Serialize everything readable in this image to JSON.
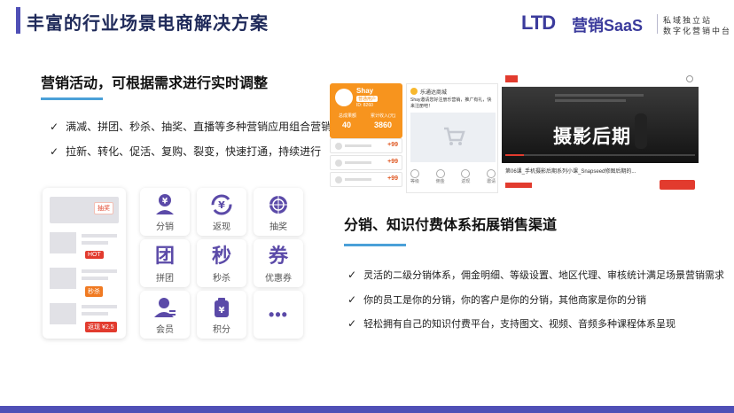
{
  "header": {
    "title": "丰富的行业场景电商解决方案",
    "logo_ltd": "LTD",
    "logo_brand": "营销SaaS",
    "tagline_1": "私域独立站",
    "tagline_2": "数字化营销中台"
  },
  "section1": {
    "title": "营销活动，可根据需求进行实时调整",
    "bullets": [
      "满减、拼团、秒杀、抽奖、直播等多种营销应用组合营销",
      "拉新、转化、促活、复购、裂变，快速打通，持续进行"
    ]
  },
  "phone": {
    "tag_lottery": "抽奖",
    "tag_hot": "HOT",
    "tag_seckill": "秒杀",
    "tag_rebate": "返现",
    "tag_price": "¥2.5"
  },
  "grid": [
    {
      "label": "分销",
      "icon": "money-person-icon"
    },
    {
      "label": "返现",
      "icon": "cashback-cycle-icon"
    },
    {
      "label": "抽奖",
      "icon": "lottery-wheel-icon"
    },
    {
      "label": "拼团",
      "icon": "group-tuan-icon",
      "glyph": "团"
    },
    {
      "label": "秒杀",
      "icon": "seckill-miao-icon",
      "glyph": "秒"
    },
    {
      "label": "优惠券",
      "icon": "coupon-quan-icon",
      "glyph": "券"
    },
    {
      "label": "会员",
      "icon": "member-user-icon"
    },
    {
      "label": "积分",
      "icon": "points-bag-icon"
    },
    {
      "label": "",
      "icon": "more-dots-icon",
      "glyph": "•••"
    }
  ],
  "orange_card": {
    "name": "Shay",
    "badge": "普通用户",
    "id": "ID: 8260",
    "stat1_label": "总成果额",
    "stat1_value": "40",
    "stat2_label": "累计收入(元)",
    "stat2_value": "3860"
  },
  "list_plus": [
    "+99",
    "+99",
    "+99"
  ],
  "msg_card": {
    "app": "乐通达商城",
    "message": "Shay邀请您好注册乐营销，推广有礼，快来注册吧！",
    "actions": [
      "等级",
      "佣金",
      "返现",
      "邀请"
    ]
  },
  "video": {
    "headline": "摄影后期",
    "caption": "第06课_手机摄影后期系列小课_Snapseed修图后期的..."
  },
  "section2": {
    "title": "分销、知识付费体系拓展销售渠道",
    "bullets": [
      "灵活的二级分销体系，佣金明细、等级设置、地区代理、审核统计满足场景营销需求",
      "你的员工是你的分销，你的客户是你的分销，其他商家是你的分销",
      "轻松拥有自己的知识付费平台，支持图文、视频、音频多种课程体系呈现"
    ]
  }
}
